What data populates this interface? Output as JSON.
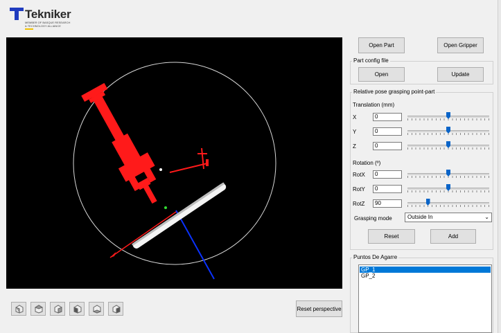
{
  "logo": {
    "name": "Tekniker",
    "tagline_1": "MEMBER OF BASQUE RESEARCH",
    "tagline_2": "& TECHNOLOGY ALLIANCE"
  },
  "buttons": {
    "open_part": "Open Part",
    "open_gripper": "Open Gripper",
    "open": "Open",
    "update": "Update",
    "reset": "Reset",
    "add": "Add",
    "reset_perspective": "Reset perspective"
  },
  "part_config": {
    "title": "Part config file"
  },
  "relative_pose": {
    "title": "Relative pose grasping point-part",
    "translation_label": "Translation (mm)",
    "rotation_label": "Rotation (º)",
    "fields": [
      {
        "label": "X",
        "value": "0",
        "slider": 0.5
      },
      {
        "label": "Y",
        "value": "0",
        "slider": 0.5
      },
      {
        "label": "Z",
        "value": "0",
        "slider": 0.5
      },
      {
        "label": "RotX",
        "value": "0",
        "slider": 0.5
      },
      {
        "label": "RotY",
        "value": "0",
        "slider": 0.5
      },
      {
        "label": "RotZ",
        "value": "90",
        "slider": 0.25
      }
    ],
    "grasping_mode_label": "Grasping mode",
    "grasping_mode_value": "Outside In"
  },
  "puntos": {
    "title": "Puntos De Agarre",
    "items": [
      "GP_1",
      "GP_2"
    ],
    "selected_index": 0
  },
  "view_buttons": [
    "view-front-icon",
    "view-top-icon",
    "view-right-icon",
    "view-left-icon",
    "view-bottom-icon",
    "view-back-icon"
  ],
  "colors": {
    "gripper": "#ff1a1a",
    "axis_blue": "#0a32ff",
    "selection": "#0078d7",
    "slider_thumb": "#0a64c8"
  }
}
